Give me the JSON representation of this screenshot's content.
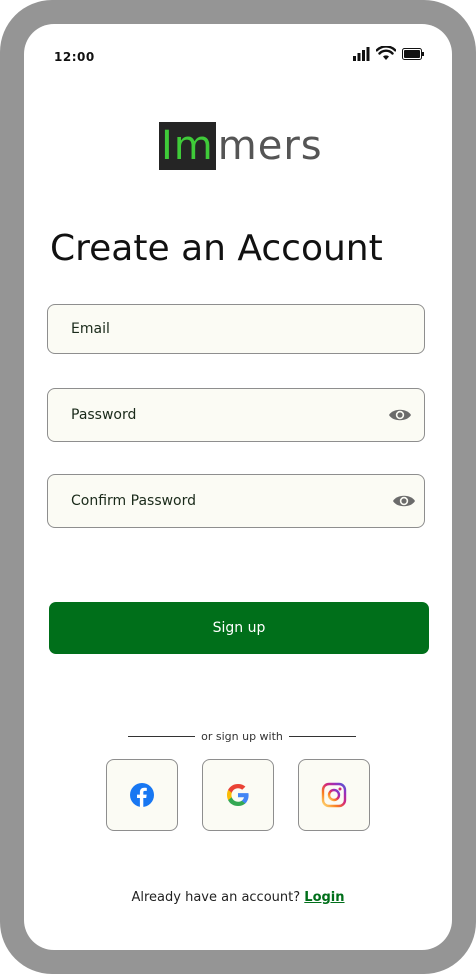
{
  "status_bar": {
    "time": "12:00",
    "icons": [
      "signal-icon",
      "wifi-icon",
      "battery-icon"
    ]
  },
  "logo": {
    "highlight": "Im",
    "rest": "mers",
    "colors": {
      "box": "#252525",
      "highlight": "#3fcb39",
      "rest": "#555555"
    }
  },
  "title": "Create an Account",
  "fields": {
    "email": {
      "placeholder": "Email"
    },
    "password": {
      "placeholder": "Password",
      "icon": "eye-icon"
    },
    "confirm_password": {
      "placeholder": "Confirm Password",
      "icon": "eye-icon"
    }
  },
  "signup_button": {
    "label": "Sign up",
    "color": "#006f1a"
  },
  "divider_text": "or sign up with",
  "social": [
    {
      "name": "facebook",
      "icon": "facebook-icon"
    },
    {
      "name": "google",
      "icon": "google-icon"
    },
    {
      "name": "instagram",
      "icon": "instagram-icon"
    }
  ],
  "footer": {
    "prompt": "Already have an account?",
    "login_label": "Login"
  }
}
